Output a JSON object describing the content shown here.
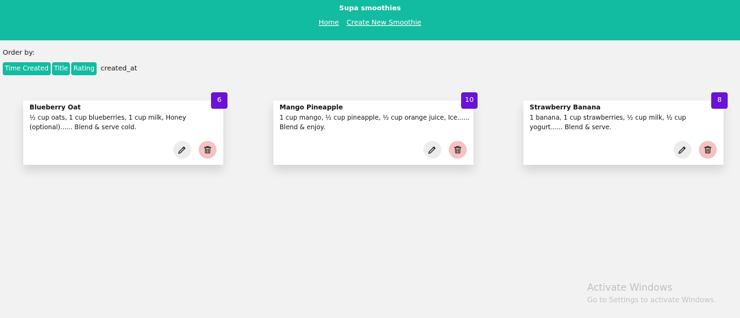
{
  "header": {
    "title": "Supa smoothies",
    "nav": [
      "Home",
      "Create New Smoothie"
    ]
  },
  "order": {
    "label": "Order by:",
    "buttons": [
      "Time Created",
      "Title",
      "Rating"
    ],
    "current": "created_at"
  },
  "smoothies": [
    {
      "title": "Blueberry Oat",
      "method": "½ cup oats, 1 cup blueberries, 1 cup milk, Honey (optional)...... Blend & serve cold.",
      "rating": "6"
    },
    {
      "title": "Mango Pineapple",
      "method": "1 cup mango, ½ cup pineapple, ½ cup orange juice, Ice...... Blend & enjoy.",
      "rating": "10"
    },
    {
      "title": "Strawberry Banana",
      "method": "1 banana, 1 cup strawberries, ½ cup milk, ½ cup yogurt...... Blend & serve.",
      "rating": "8"
    }
  ],
  "icons": {
    "edit": "pencil-icon",
    "delete": "trash-icon"
  },
  "watermark": {
    "title": "Activate Windows",
    "subtitle": "Go to Settings to activate Windows."
  },
  "colors": {
    "header": "#12bca1",
    "rating_badge": "#6a12d7",
    "delete_bg": "#f6c1c1"
  }
}
